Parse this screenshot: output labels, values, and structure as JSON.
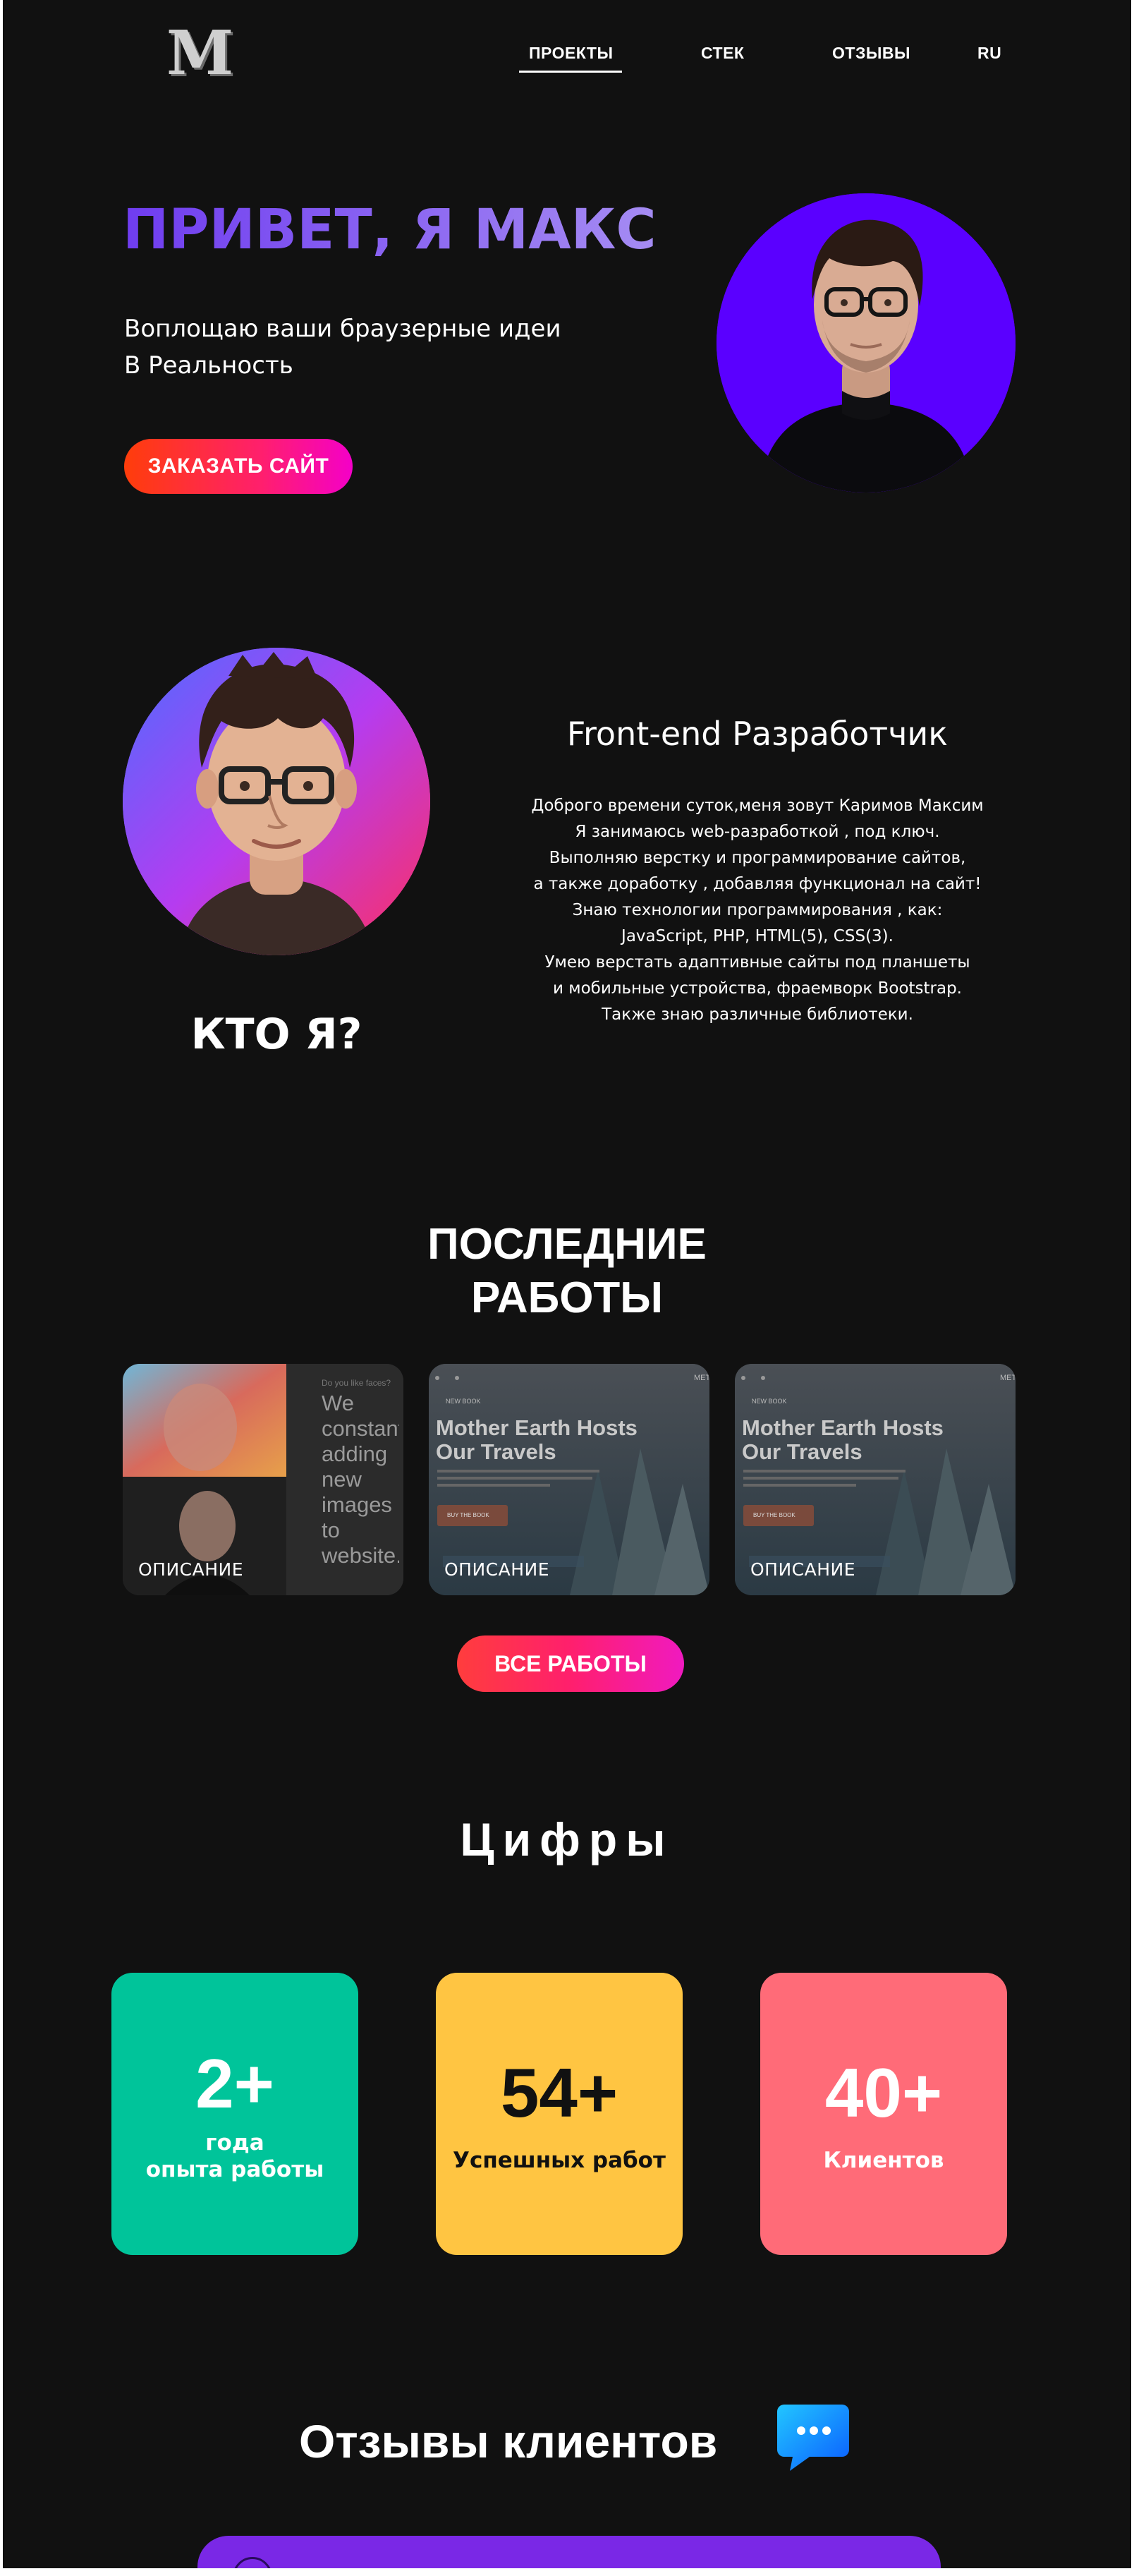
{
  "header": {
    "logo_text": "M",
    "nav": [
      {
        "label": "ПРОЕКТЫ",
        "active": true
      },
      {
        "label": "СТЕК"
      },
      {
        "label": "ОТЗЫВЫ"
      },
      {
        "label": "RU"
      }
    ]
  },
  "hero": {
    "title": "ПРИВЕТ, Я МАКС",
    "subtitle_line1": "Воплощаю ваши браузерные идеи",
    "subtitle_line2": "В Реальность",
    "cta_label": "ЗАКАЗАТЬ САЙТ"
  },
  "about": {
    "title": "КТО Я?",
    "role": "Front-end Разработчик",
    "bio": "Доброго времени суток,меня зовут Каримов Максим\nЯ занимаюсь web-разработкой , под ключ.\nВыполняю верстку и программирование сайтов,\nа также доработку , добавляя  функционал на сайт!\nЗнаю технологии программирования , как:\nJavaScript, PHP, HTML(5), CSS(3).\nУмею верстать адаптивные сайты под планшеты\nи мобильные устройства, фраемворк Bootstrap.\nТакже знаю различные библиотеки."
  },
  "works": {
    "title_line1": "ПОСЛЕДНИЕ",
    "title_line2": "РАБОТЫ",
    "cards": [
      {
        "label": "ОПИСАНИЕ",
        "preview_small": "Do you like faces?",
        "preview_text": "We constantly adding new images to website. Does it make sense?"
      },
      {
        "label": "ОПИСАНИЕ",
        "preview_kicker": "NEW BOOK",
        "preview_title": "Mother Earth Hosts Our Travels",
        "preview_button": "BUY THE BOOK",
        "preview_corner": "MET"
      },
      {
        "label": "ОПИСАНИЕ",
        "preview_kicker": "NEW BOOK",
        "preview_title": "Mother Earth Hosts Our Travels",
        "preview_button": "BUY THE BOOK",
        "preview_corner": "MET"
      }
    ],
    "all_label": "ВСЕ РАБОТЫ"
  },
  "numbers": {
    "title": "Цифры",
    "stats": [
      {
        "value": "2+",
        "label_line1": "года",
        "label_line2": "опыта работы",
        "bg": "#00c49a",
        "fg": "#ffffff"
      },
      {
        "value": "54+",
        "label_line1": "Успешных работ",
        "label_line2": "",
        "bg": "#ffc542",
        "fg": "#111111"
      },
      {
        "value": "40+",
        "label_line1": "Клиентов",
        "label_line2": "",
        "bg": "#ff6b78",
        "fg": "#ffffff"
      }
    ]
  },
  "reviews": {
    "title": "Отзывы клиентов"
  },
  "colors": {
    "page_bg": "#111111",
    "hero_accent": "#7b4cf2",
    "cta_gradient_start": "#ff3d0a",
    "cta_gradient_end": "#f400c8",
    "review_bar": "#7a28e6",
    "chat_icon": "#1a8cff"
  }
}
